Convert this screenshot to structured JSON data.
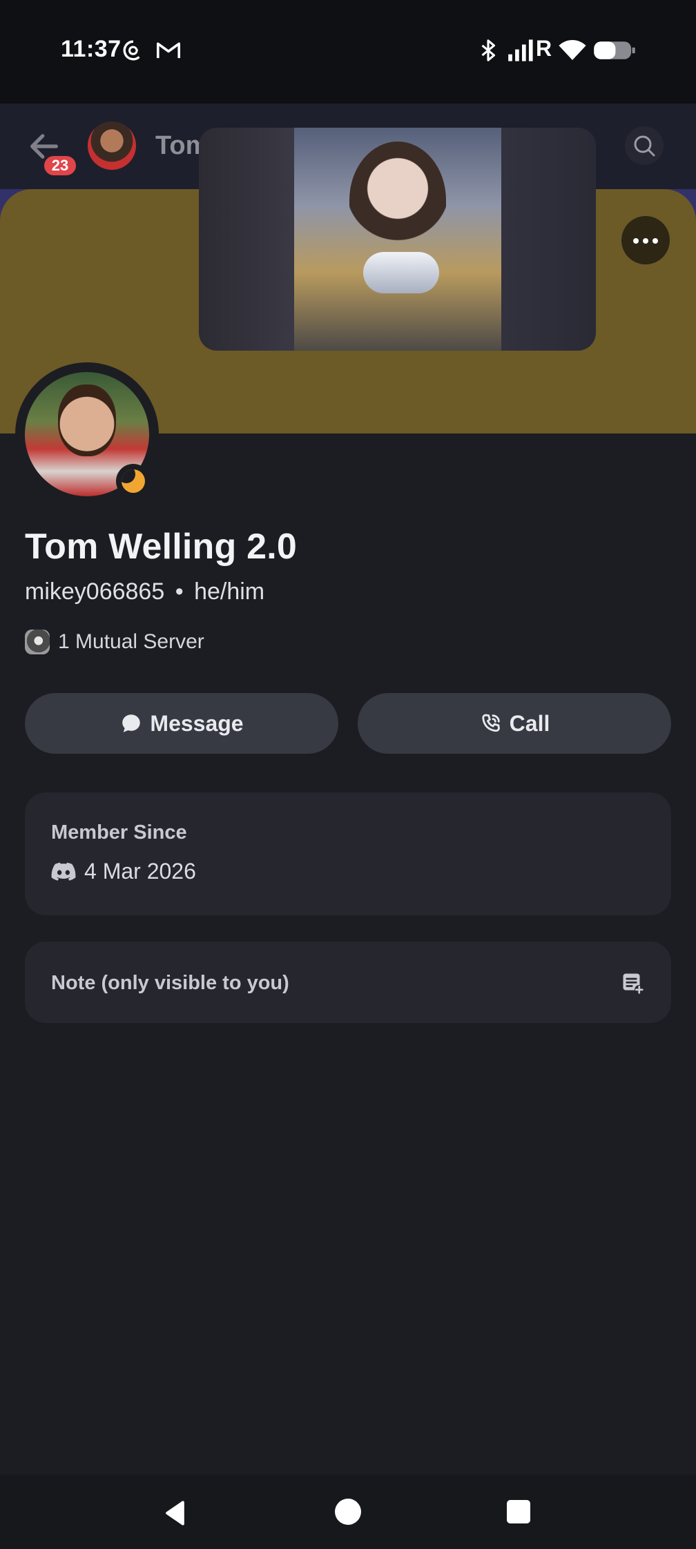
{
  "status_bar": {
    "time": "11:37",
    "notification_icons": [
      "threads-icon",
      "gmail-icon"
    ],
    "system_icons": [
      "bluetooth-icon",
      "cellular-signal-icon",
      "roaming-r-icon",
      "wifi-icon",
      "battery-icon"
    ],
    "roaming_label": "R"
  },
  "header": {
    "back_icon": "arrow-left-icon",
    "unread_badge": "23",
    "name_partial": "Tom",
    "search_icon": "search-icon",
    "more_icon": "more-horizontal-icon"
  },
  "pip_video": {
    "description_icon": "video-thumbnail"
  },
  "profile": {
    "display_name": "Tom Welling 2.0",
    "username": "mikey066865",
    "separator": "•",
    "pronouns": "he/him",
    "status": "idle",
    "mutual_servers": "1 Mutual Server"
  },
  "actions": {
    "message_label": "Message",
    "call_label": "Call"
  },
  "member_since": {
    "label": "Member Since",
    "date": "4 Mar 2026"
  },
  "note": {
    "label": "Note (only visible to you)"
  },
  "colors": {
    "background": "#1c1d22",
    "banner": "#6c5a27",
    "card": "#25262e",
    "button": "#373943",
    "badge": "#e0454a",
    "idle_status": "#f0a631"
  }
}
